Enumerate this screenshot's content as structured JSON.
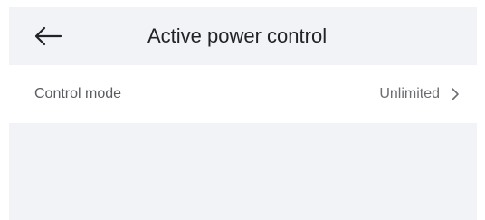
{
  "header": {
    "title": "Active power control",
    "back_icon": "arrow-left-icon"
  },
  "settings": {
    "control_mode": {
      "label": "Control mode",
      "value": "Unlimited",
      "icon": "chevron-right-icon"
    }
  },
  "colors": {
    "header_bg": "#f2f3f7",
    "title_text": "#222326",
    "label_text": "#5a5c61",
    "value_text": "#6b6d72"
  }
}
